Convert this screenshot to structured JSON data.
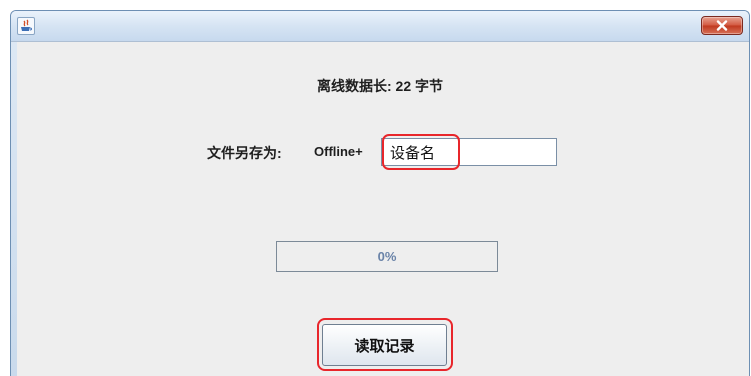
{
  "window": {
    "app_icon": "java-icon",
    "close_icon": "close-icon"
  },
  "dialog": {
    "data_length_label": "离线数据长: 22 字节",
    "save_as_label": "文件另存为:",
    "save_as_prefix": "Offline+",
    "device_name_value": "设备名",
    "progress_text": "0%",
    "progress_value": 0,
    "read_button_label": "读取记录"
  },
  "colors": {
    "highlight": "#e8262b",
    "close_button": "#c0391f"
  }
}
